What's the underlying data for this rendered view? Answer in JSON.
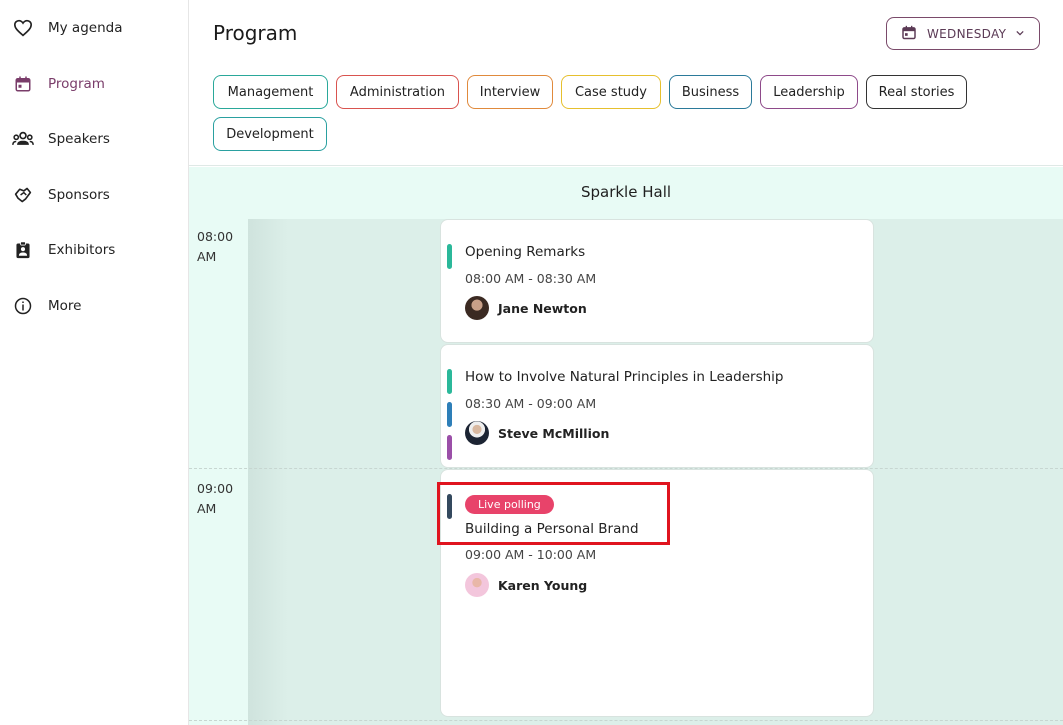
{
  "sidebar": {
    "items": [
      {
        "label": "My agenda",
        "icon": "heart-icon"
      },
      {
        "label": "Program",
        "icon": "calendar-icon",
        "active": true
      },
      {
        "label": "Speakers",
        "icon": "people-icon"
      },
      {
        "label": "Sponsors",
        "icon": "handshake-icon"
      },
      {
        "label": "Exhibitors",
        "icon": "badge-icon"
      },
      {
        "label": "More",
        "icon": "info-icon"
      }
    ]
  },
  "header": {
    "title": "Program",
    "day_select": {
      "value": "WEDNESDAY",
      "icon": "calendar-icon"
    }
  },
  "tags": [
    {
      "label": "Management",
      "color": "#2aa89a"
    },
    {
      "label": "Administration",
      "color": "#d9534f"
    },
    {
      "label": "Interview",
      "color": "#e08a3c"
    },
    {
      "label": "Case study",
      "color": "#e6c02e"
    },
    {
      "label": "Business",
      "color": "#2b7a9a"
    },
    {
      "label": "Leadership",
      "color": "#8e4a8a"
    },
    {
      "label": "Real stories",
      "color": "#333333"
    },
    {
      "label": "Development",
      "color": "#2aa0a0"
    }
  ],
  "schedule": {
    "hall": "Sparkle Hall",
    "times": [
      {
        "hour": "08:00",
        "period": "AM"
      },
      {
        "hour": "09:00",
        "period": "AM"
      }
    ],
    "sessions": [
      {
        "title": "Opening Remarks",
        "time": "08:00 AM - 08:30 AM",
        "speaker": "Jane Newton",
        "bar_colors": [
          "#2bb89a"
        ]
      },
      {
        "title": "How to Involve Natural Principles in Leadership",
        "time": "08:30 AM - 09:00 AM",
        "speaker": "Steve McMillion",
        "bar_colors": [
          "#2bb89a",
          "#2e7fb8",
          "#9b4fa8"
        ]
      },
      {
        "badge": "Live polling",
        "title": "Building a Personal Brand",
        "time": "09:00 AM - 10:00 AM",
        "speaker": "Karen Young",
        "bar_colors": [
          "#34495e"
        ]
      }
    ]
  }
}
